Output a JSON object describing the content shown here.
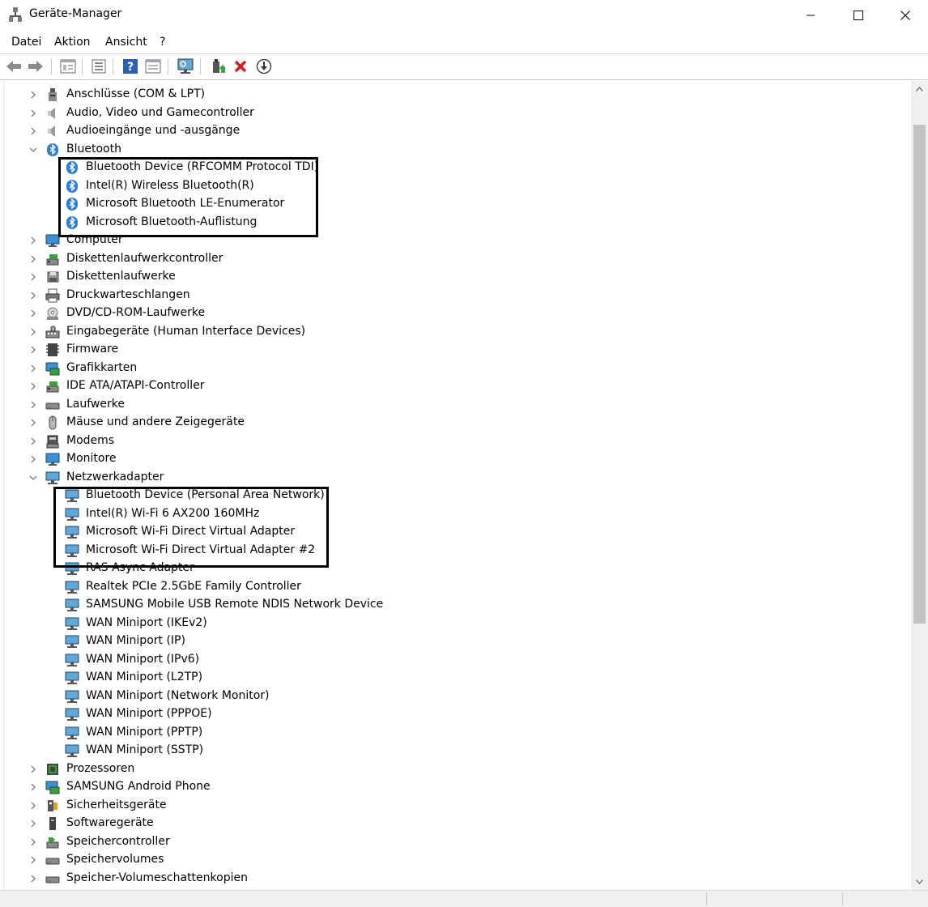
{
  "window": {
    "title": "Geräte-Manager"
  },
  "menu": [
    "Datei",
    "Aktion",
    "Ansicht",
    "?"
  ],
  "toolbar": [
    "back-icon",
    "forward-icon",
    "properties-view-icon",
    "list-view-icon",
    "help-icon",
    "details-view-icon",
    "scan-hardware-icon",
    "update-driver-icon",
    "uninstall-icon",
    "download-icon"
  ],
  "tree": [
    {
      "label": "Anschlüsse (COM & LPT)",
      "level": 0,
      "expanded": false,
      "icon": "port-icon"
    },
    {
      "label": "Audio, Video und Gamecontroller",
      "level": 0,
      "expanded": false,
      "icon": "speaker-icon"
    },
    {
      "label": "Audioeingänge und -ausgänge",
      "level": 0,
      "expanded": false,
      "icon": "speaker-icon"
    },
    {
      "label": "Bluetooth",
      "level": 0,
      "expanded": true,
      "icon": "bluetooth-icon"
    },
    {
      "label": "Bluetooth Device (RFCOMM Protocol TDI)",
      "level": 1,
      "icon": "bluetooth-icon"
    },
    {
      "label": "Intel(R) Wireless Bluetooth(R)",
      "level": 1,
      "icon": "bluetooth-icon"
    },
    {
      "label": "Microsoft Bluetooth LE-Enumerator",
      "level": 1,
      "icon": "bluetooth-icon"
    },
    {
      "label": "Microsoft Bluetooth-Auflistung",
      "level": 1,
      "icon": "bluetooth-icon"
    },
    {
      "label": "Computer",
      "level": 0,
      "expanded": false,
      "icon": "monitor-icon"
    },
    {
      "label": "Diskettenlaufwerkcontroller",
      "level": 0,
      "expanded": false,
      "icon": "controller-icon"
    },
    {
      "label": "Diskettenlaufwerke",
      "level": 0,
      "expanded": false,
      "icon": "floppy-icon"
    },
    {
      "label": "Druckwarteschlangen",
      "level": 0,
      "expanded": false,
      "icon": "printer-icon"
    },
    {
      "label": "DVD/CD-ROM-Laufwerke",
      "level": 0,
      "expanded": false,
      "icon": "disc-icon"
    },
    {
      "label": "Eingabegeräte (Human Interface Devices)",
      "level": 0,
      "expanded": false,
      "icon": "hid-icon"
    },
    {
      "label": "Firmware",
      "level": 0,
      "expanded": false,
      "icon": "chip-icon"
    },
    {
      "label": "Grafikkarten",
      "level": 0,
      "expanded": false,
      "icon": "display-adapter-icon"
    },
    {
      "label": "IDE ATA/ATAPI-Controller",
      "level": 0,
      "expanded": false,
      "icon": "controller-icon"
    },
    {
      "label": "Laufwerke",
      "level": 0,
      "expanded": false,
      "icon": "drive-icon"
    },
    {
      "label": "Mäuse und andere Zeigegeräte",
      "level": 0,
      "expanded": false,
      "icon": "mouse-icon"
    },
    {
      "label": "Modems",
      "level": 0,
      "expanded": false,
      "icon": "modem-icon"
    },
    {
      "label": "Monitore",
      "level": 0,
      "expanded": false,
      "icon": "monitor-icon"
    },
    {
      "label": "Netzwerkadapter",
      "level": 0,
      "expanded": true,
      "icon": "network-icon"
    },
    {
      "label": "Bluetooth Device (Personal Area Network)",
      "level": 1,
      "icon": "network-icon"
    },
    {
      "label": "Intel(R) Wi-Fi 6 AX200 160MHz",
      "level": 1,
      "icon": "network-icon"
    },
    {
      "label": "Microsoft Wi-Fi Direct Virtual Adapter",
      "level": 1,
      "icon": "network-icon"
    },
    {
      "label": "Microsoft Wi-Fi Direct Virtual Adapter #2",
      "level": 1,
      "icon": "network-icon"
    },
    {
      "label": "RAS Async Adapter",
      "level": 1,
      "icon": "network-icon"
    },
    {
      "label": "Realtek PCIe 2.5GbE Family Controller",
      "level": 1,
      "icon": "network-icon"
    },
    {
      "label": "SAMSUNG Mobile USB Remote NDIS Network Device",
      "level": 1,
      "icon": "network-icon"
    },
    {
      "label": "WAN Miniport (IKEv2)",
      "level": 1,
      "icon": "network-icon"
    },
    {
      "label": "WAN Miniport (IP)",
      "level": 1,
      "icon": "network-icon"
    },
    {
      "label": "WAN Miniport (IPv6)",
      "level": 1,
      "icon": "network-icon"
    },
    {
      "label": "WAN Miniport (L2TP)",
      "level": 1,
      "icon": "network-icon"
    },
    {
      "label": "WAN Miniport (Network Monitor)",
      "level": 1,
      "icon": "network-icon"
    },
    {
      "label": "WAN Miniport (PPPOE)",
      "level": 1,
      "icon": "network-icon"
    },
    {
      "label": "WAN Miniport (PPTP)",
      "level": 1,
      "icon": "network-icon"
    },
    {
      "label": "WAN Miniport (SSTP)",
      "level": 1,
      "icon": "network-icon"
    },
    {
      "label": "Prozessoren",
      "level": 0,
      "expanded": false,
      "icon": "cpu-icon"
    },
    {
      "label": "SAMSUNG Android Phone",
      "level": 0,
      "expanded": false,
      "icon": "display-adapter-icon"
    },
    {
      "label": "Sicherheitsgeräte",
      "level": 0,
      "expanded": false,
      "icon": "security-icon"
    },
    {
      "label": "Softwaregeräte",
      "level": 0,
      "expanded": false,
      "icon": "software-icon"
    },
    {
      "label": "Speichercontroller",
      "level": 0,
      "expanded": false,
      "icon": "storage-controller-icon"
    },
    {
      "label": "Speichervolumes",
      "level": 0,
      "expanded": false,
      "icon": "drive-icon"
    },
    {
      "label": "Speicher-Volumeschattenkopien",
      "level": 0,
      "expanded": false,
      "icon": "drive-icon"
    }
  ]
}
